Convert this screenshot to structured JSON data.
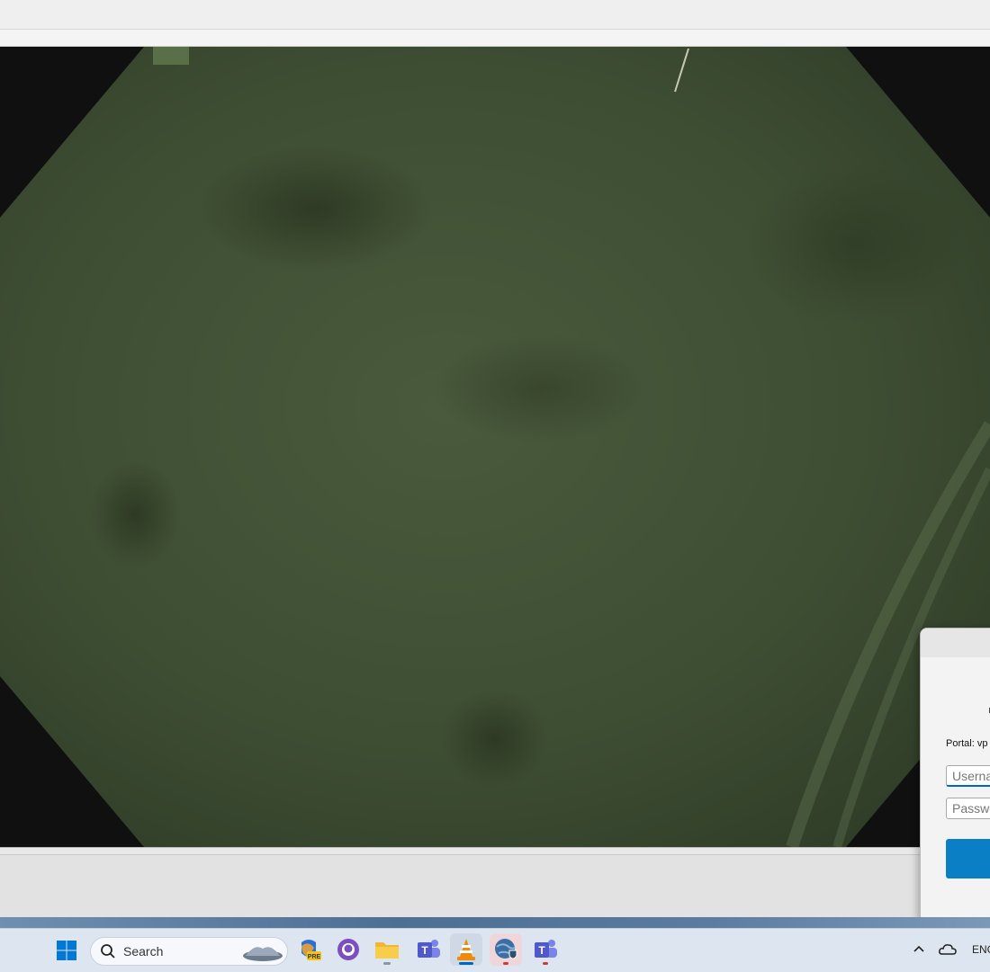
{
  "taskbar": {
    "search_label": "Search",
    "tray_language": "ENG",
    "items": [
      {
        "name": "windows-start",
        "icon": "windows-logo-icon"
      },
      {
        "name": "copilot-pre",
        "icon": "copilot-icon",
        "badge": "PRE"
      },
      {
        "name": "github-desktop",
        "icon": "github-icon"
      },
      {
        "name": "file-explorer",
        "icon": "folder-icon"
      },
      {
        "name": "teams",
        "icon": "teams-icon"
      },
      {
        "name": "vlc",
        "icon": "vlc-cone-icon"
      },
      {
        "name": "vpn-globe",
        "icon": "globe-shield-icon"
      },
      {
        "name": "teams-2",
        "icon": "teams-icon"
      }
    ]
  },
  "dialog": {
    "portal_label": "Portal: vp",
    "username_placeholder": "Username",
    "password_placeholder": "Password"
  },
  "colors": {
    "accent": "#0a7fc6",
    "taskbar_bg": "#dde6f0",
    "video_tint": "#3f4f33"
  }
}
